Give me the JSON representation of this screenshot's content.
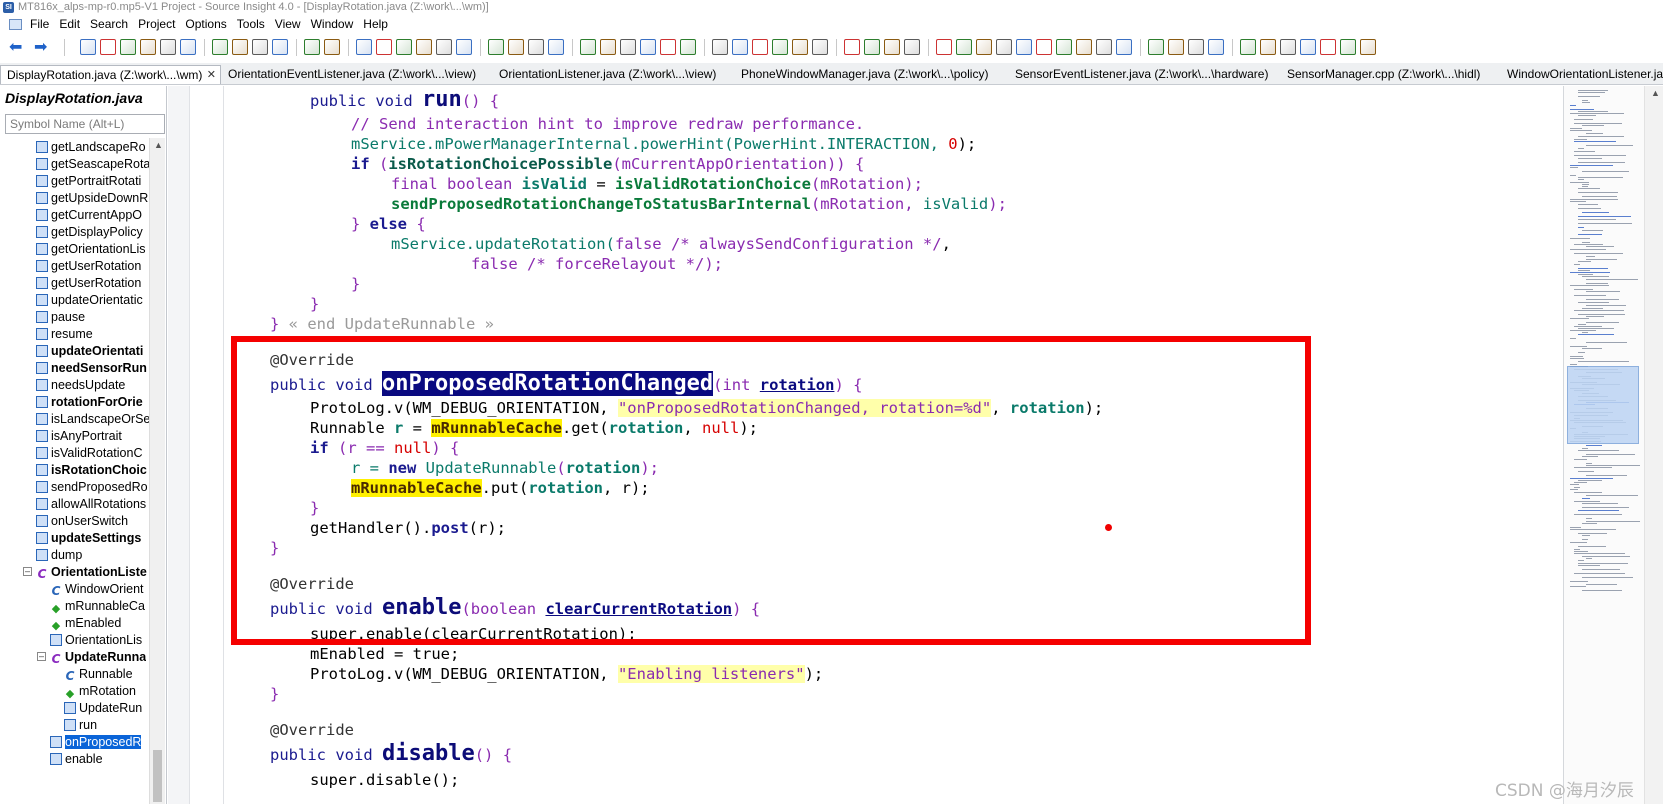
{
  "window": {
    "title": "MT816x_alps-mp-r0.mp5-V1 Project - Source Insight 4.0 - [DisplayRotation.java (Z:\\work\\...\\wm)]"
  },
  "menu": [
    "File",
    "Edit",
    "Search",
    "Project",
    "Options",
    "Tools",
    "View",
    "Window",
    "Help"
  ],
  "toolbar": {
    "back_icon": "back-arrow-icon",
    "forward_icon": "forward-arrow-icon",
    "colors": [
      "#3a6fc2",
      "#c33",
      "#2d7d2d",
      "#8a5a12",
      "#5a5a5a"
    ]
  },
  "tabs": [
    "DisplayRotation.java (Z:\\work\\...\\wm)",
    "OrientationEventListener.java (Z:\\work\\...\\view)",
    "OrientationListener.java (Z:\\work\\...\\view)",
    "PhoneWindowManager.java (Z:\\work\\...\\policy)",
    "SensorEventListener.java (Z:\\work\\...\\hardware)",
    "SensorManager.cpp (Z:\\work\\...\\hidl)",
    "WindowOrientationListener.ja"
  ],
  "sidebar": {
    "file_title": "DisplayRotation.java",
    "search_placeholder": "Symbol Name (Alt+L)",
    "items": [
      {
        "label": "getLandscapeRo",
        "kind": "method",
        "bold": false,
        "indent": 0
      },
      {
        "label": "getSeascapeRota",
        "kind": "method",
        "bold": false,
        "indent": 0
      },
      {
        "label": "getPortraitRotati",
        "kind": "method",
        "bold": false,
        "indent": 0
      },
      {
        "label": "getUpsideDownR",
        "kind": "method",
        "bold": false,
        "indent": 0
      },
      {
        "label": "getCurrentAppO",
        "kind": "method",
        "bold": false,
        "indent": 0
      },
      {
        "label": "getDisplayPolicy",
        "kind": "method",
        "bold": false,
        "indent": 0
      },
      {
        "label": "getOrientationLis",
        "kind": "method",
        "bold": false,
        "indent": 0
      },
      {
        "label": "getUserRotation",
        "kind": "method",
        "bold": false,
        "indent": 0
      },
      {
        "label": "getUserRotation",
        "kind": "method",
        "bold": false,
        "indent": 0
      },
      {
        "label": "updateOrientatic",
        "kind": "method",
        "bold": false,
        "indent": 0
      },
      {
        "label": "pause",
        "kind": "method",
        "bold": false,
        "indent": 0
      },
      {
        "label": "resume",
        "kind": "method",
        "bold": false,
        "indent": 0
      },
      {
        "label": "updateOrientati",
        "kind": "method",
        "bold": true,
        "indent": 0
      },
      {
        "label": "needSensorRun",
        "kind": "method",
        "bold": true,
        "indent": 0
      },
      {
        "label": "needsUpdate",
        "kind": "method",
        "bold": false,
        "indent": 0
      },
      {
        "label": "rotationForOrie",
        "kind": "method",
        "bold": true,
        "indent": 0
      },
      {
        "label": "isLandscapeOrSe",
        "kind": "method",
        "bold": false,
        "indent": 0
      },
      {
        "label": "isAnyPortrait",
        "kind": "method",
        "bold": false,
        "indent": 0
      },
      {
        "label": "isValidRotationC",
        "kind": "method",
        "bold": false,
        "indent": 0
      },
      {
        "label": "isRotationChoic",
        "kind": "method",
        "bold": true,
        "indent": 0
      },
      {
        "label": "sendProposedRo",
        "kind": "method",
        "bold": false,
        "indent": 0
      },
      {
        "label": "allowAllRotations",
        "kind": "method",
        "bold": false,
        "indent": 0
      },
      {
        "label": "onUserSwitch",
        "kind": "method",
        "bold": false,
        "indent": 0
      },
      {
        "label": "updateSettings",
        "kind": "method",
        "bold": true,
        "indent": 0
      },
      {
        "label": "dump",
        "kind": "method",
        "bold": false,
        "indent": 0
      },
      {
        "label": "OrientationListe",
        "kind": "class",
        "bold": true,
        "indent": 0
      },
      {
        "label": "WindowOrient",
        "kind": "ctor",
        "bold": false,
        "indent": 1
      },
      {
        "label": "mRunnableCa",
        "kind": "field",
        "bold": false,
        "indent": 1
      },
      {
        "label": "mEnabled",
        "kind": "field",
        "bold": false,
        "indent": 1
      },
      {
        "label": "OrientationLis",
        "kind": "method",
        "bold": false,
        "indent": 1
      },
      {
        "label": "UpdateRunna",
        "kind": "class",
        "bold": true,
        "indent": 1
      },
      {
        "label": "Runnable",
        "kind": "ctor",
        "bold": false,
        "indent": 2
      },
      {
        "label": "mRotation",
        "kind": "field",
        "bold": false,
        "indent": 2
      },
      {
        "label": "UpdateRun",
        "kind": "method",
        "bold": false,
        "indent": 2
      },
      {
        "label": "run",
        "kind": "method",
        "bold": false,
        "indent": 2
      },
      {
        "label": "onProposedR",
        "kind": "method",
        "bold": false,
        "indent": 1,
        "selected": true
      },
      {
        "label": "enable",
        "kind": "method",
        "bold": false,
        "indent": 1
      }
    ]
  },
  "code": {
    "run_signature": {
      "pre": "public void ",
      "name": "run",
      "post": "() {"
    },
    "line_hint_comment": "// Send interaction hint to improve redraw performance.",
    "line_power_hint": {
      "pre": "mService.mPowerManagerInternal.powerHint(PowerHint.INTERACTION, ",
      "num": "0",
      "post": ");"
    },
    "line_if_choice": {
      "kw": "if",
      "open": " (",
      "call": "isRotationChoicePossible",
      "arg": "(mCurrentAppOrientation)",
      "close": ") {"
    },
    "line_final": {
      "kw": "final boolean ",
      "var": "isValid",
      "eq": " = ",
      "call": "isValidRotationChoice",
      "arg": "(mRotation);"
    },
    "line_send": {
      "call": "sendProposedRotationChangeToStatusBarInternal",
      "a": "(mRotation, ",
      "b": "isValid",
      "c": ");"
    },
    "line_else": {
      "close": "} ",
      "kw": "else",
      "post": " {"
    },
    "line_update": {
      "pre": "mService.updateRotation(",
      "lit": "false",
      "cm": " /* alwaysSendConfiguration */",
      "post": ","
    },
    "line_update2": {
      "lit": "false",
      "cm": " /* forceRelayout */",
      "post": ");"
    },
    "brace_close": "}",
    "end_runnable": {
      "brace": "} ",
      "comment": "« end UpdateRunnable »"
    },
    "override": "@Override",
    "onproposed_sig": {
      "pre": "public void ",
      "name": "onProposedRotationChanged",
      "open": "(int ",
      "param": "rotation",
      "close": ") {"
    },
    "line_protolog": {
      "pre": "ProtoLog.v(WM_DEBUG_ORIENTATION, ",
      "str": "\"onProposedRotationChanged, rotation=%d\"",
      "sep": ", ",
      "var": "rotation",
      "post": ");"
    },
    "line_runnable": {
      "pre": "Runnable ",
      "var": "r",
      "eq": " = ",
      "hl": "mRunnableCache",
      "post": ".get(",
      "arg": "rotation",
      "sep": ", ",
      "lit": "null",
      "end": ");"
    },
    "line_if_null": {
      "kw": "if",
      "open": " (r == ",
      "lit": "null",
      "close": ") {"
    },
    "line_new": {
      "pre": "r = ",
      "kw": "new",
      "cls": " UpdateRunnable",
      "open": "(",
      "arg": "rotation",
      "close": ");"
    },
    "line_put": {
      "hl": "mRunnableCache",
      "post": ".put(",
      "arg": "rotation",
      "tail": ", r);"
    },
    "line_handler": {
      "pre": "getHandler()",
      "dot": ".",
      "call": "post",
      "post": "(r);"
    },
    "enable_sig": {
      "pre": "public void ",
      "name": "enable",
      "open": "(boolean ",
      "param": "clearCurrentRotation",
      "close": ") {"
    },
    "line_super_enable": "super.enable(clearCurrentRotation);",
    "line_menabled": "mEnabled = true;",
    "line_protolog2": {
      "pre": "ProtoLog.v(WM_DEBUG_ORIENTATION, ",
      "str": "\"Enabling listeners\"",
      "post": ");"
    },
    "disable_sig": {
      "pre": "public void ",
      "name": "disable",
      "post": "() {"
    },
    "line_super_disable": "super.disable();"
  },
  "annotation": {
    "highlight_color": "#f50000"
  },
  "watermark": "CSDN @海月汐辰"
}
